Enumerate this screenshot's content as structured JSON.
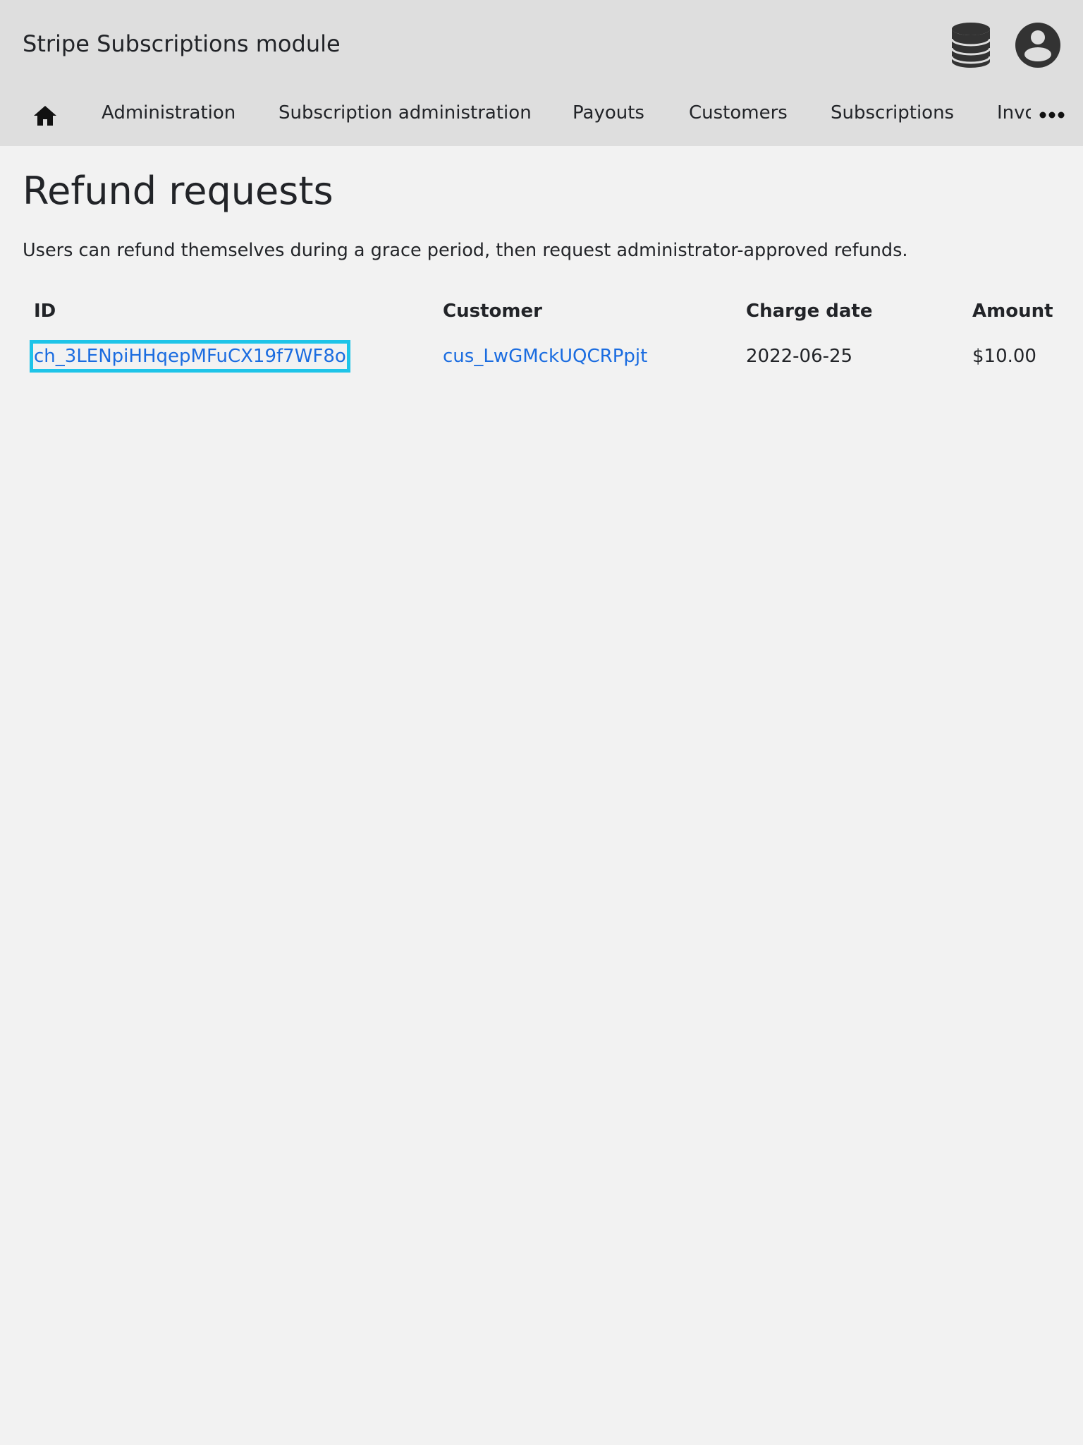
{
  "header": {
    "app_title": "Stripe Subscriptions module",
    "icons": [
      "database-icon",
      "user-account-icon"
    ]
  },
  "nav": {
    "home_icon": "home-icon",
    "items": [
      {
        "label": "Administration"
      },
      {
        "label": "Subscription administration"
      },
      {
        "label": "Payouts"
      },
      {
        "label": "Customers"
      },
      {
        "label": "Subscriptions"
      },
      {
        "label": "Invoices"
      }
    ],
    "more_icon": "more-horizontal-icon"
  },
  "main": {
    "title": "Refund requests",
    "description": "Users can refund themselves during a grace period, then request administrator-approved refunds.",
    "table": {
      "columns": [
        "ID",
        "Customer",
        "Charge date",
        "Amount"
      ],
      "rows": [
        {
          "id": "ch_3LENpiHHqepMFuCX19f7WF8o",
          "customer": "cus_LwGMckUQCRPpjt",
          "charge_date": "2022-06-25",
          "amount": "$10.00"
        }
      ]
    }
  },
  "colors": {
    "header_bg": "#dedede",
    "page_bg": "#f2f2f2",
    "link": "#1a6ce0",
    "focus_ring": "#1ec4e8",
    "icon": "#333333"
  }
}
